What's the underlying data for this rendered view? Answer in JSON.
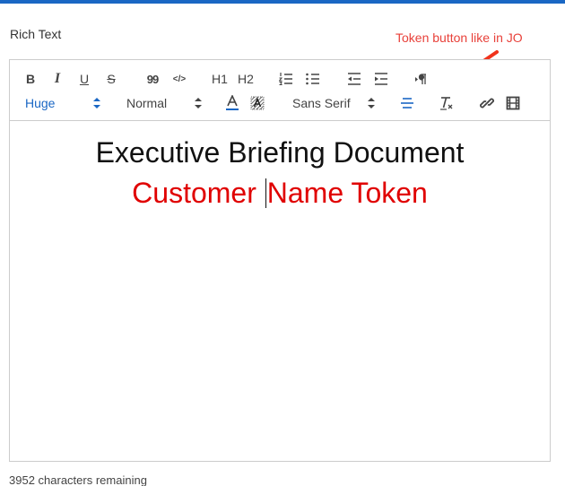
{
  "field": {
    "label": "Rich Text"
  },
  "annotation": {
    "text": "Token button like in JO",
    "color": "#e8413a"
  },
  "toolbar": {
    "row1": [
      {
        "name": "bold",
        "glyph": "B"
      },
      {
        "name": "italic",
        "glyph": "I"
      },
      {
        "name": "underline",
        "glyph": "U"
      },
      {
        "name": "strike",
        "glyph": "S"
      },
      {
        "name": "blockquote",
        "glyph": "99"
      },
      {
        "name": "code",
        "glyph": "</>"
      },
      {
        "name": "header-1",
        "glyph": "H1"
      },
      {
        "name": "header-2",
        "glyph": "H2"
      },
      {
        "name": "ordered-list",
        "icon": "ordered-list-icon"
      },
      {
        "name": "bullet-list",
        "icon": "bullet-list-icon"
      },
      {
        "name": "outdent",
        "icon": "outdent-icon"
      },
      {
        "name": "indent",
        "icon": "indent-icon"
      },
      {
        "name": "direction",
        "icon": "text-direction-icon"
      }
    ],
    "size_select": {
      "value": "Huge"
    },
    "header_select": {
      "value": "Normal"
    },
    "font_select": {
      "value": "Sans Serif"
    },
    "row2_icons": [
      "text-color-icon",
      "background-color-icon",
      "align-center-icon",
      "clear-format-icon",
      "link-icon",
      "video-icon"
    ],
    "accent_color": "#1a67c4"
  },
  "content": {
    "line1": "Executive Briefing Document",
    "line2_before": "Customer ",
    "line2_after": "Name Token",
    "line2_color": "#e00000"
  },
  "footer": {
    "remaining": "3952 characters remaining"
  }
}
